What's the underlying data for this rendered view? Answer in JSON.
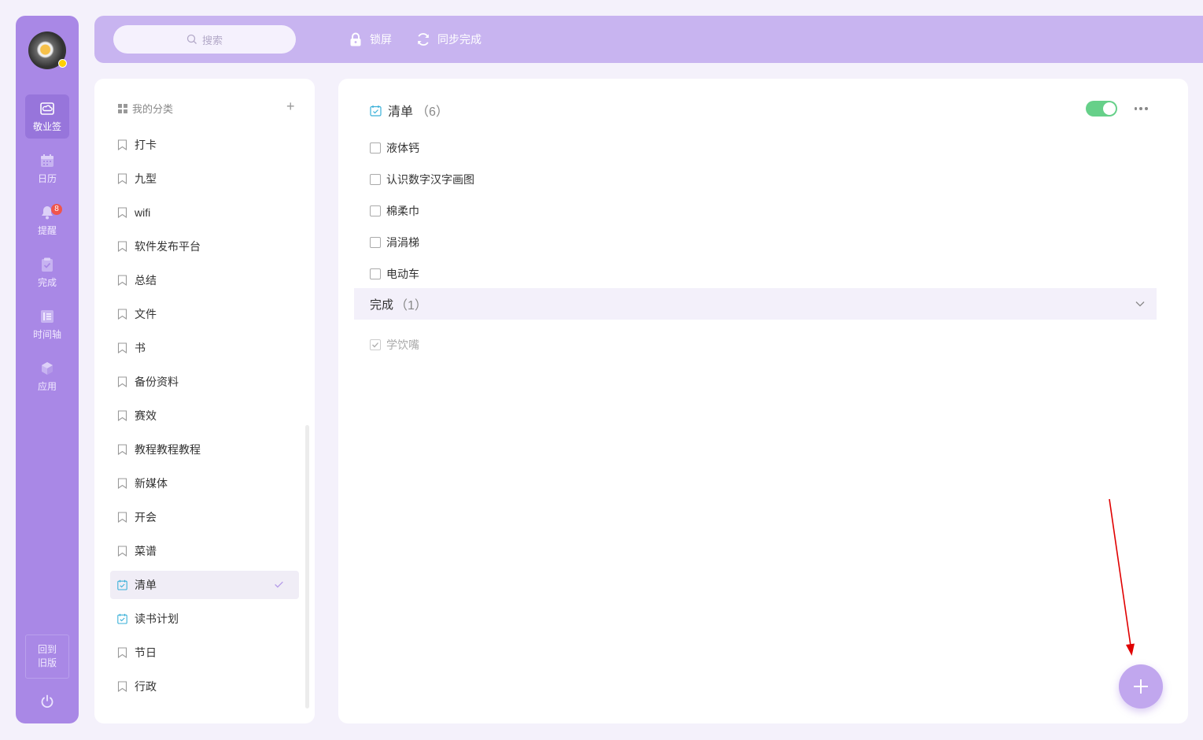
{
  "sidebar": {
    "items": [
      {
        "label": "敬业签",
        "icon": "cloud-note-icon",
        "active": true
      },
      {
        "label": "日历",
        "icon": "calendar-icon"
      },
      {
        "label": "提醒",
        "icon": "bell-icon",
        "badge": "8"
      },
      {
        "label": "完成",
        "icon": "clipboard-check-icon"
      },
      {
        "label": "时间轴",
        "icon": "timeline-icon"
      },
      {
        "label": "应用",
        "icon": "cube-icon"
      }
    ],
    "old_version_line1": "回到",
    "old_version_line2": "旧版"
  },
  "topbar": {
    "search_placeholder": "搜索",
    "lock_label": "锁屏",
    "sync_label": "同步完成"
  },
  "categories": {
    "header": "我的分类",
    "add_symbol": "+",
    "items": [
      {
        "label": "打卡",
        "icon": "bookmark-icon"
      },
      {
        "label": "九型",
        "icon": "bookmark-icon"
      },
      {
        "label": "wifi",
        "icon": "bookmark-icon"
      },
      {
        "label": "软件发布平台",
        "icon": "bookmark-icon"
      },
      {
        "label": "总结",
        "icon": "bookmark-icon"
      },
      {
        "label": "文件",
        "icon": "bookmark-icon"
      },
      {
        "label": "书",
        "icon": "bookmark-icon"
      },
      {
        "label": "备份资料",
        "icon": "bookmark-icon"
      },
      {
        "label": "赛效",
        "icon": "bookmark-icon"
      },
      {
        "label": "教程教程教程",
        "icon": "bookmark-icon"
      },
      {
        "label": "新媒体",
        "icon": "bookmark-icon"
      },
      {
        "label": "开会",
        "icon": "bookmark-icon"
      },
      {
        "label": "菜谱",
        "icon": "bookmark-icon"
      },
      {
        "label": "清单",
        "icon": "calendar-check-icon",
        "selected": true
      },
      {
        "label": "读书计划",
        "icon": "calendar-check-icon"
      },
      {
        "label": "节日",
        "icon": "bookmark-icon"
      },
      {
        "label": "行政",
        "icon": "bookmark-icon"
      }
    ]
  },
  "main": {
    "title": "清单",
    "count": "（6）",
    "toggle_on": true,
    "tasks": [
      "液体钙",
      "认识数字汉字画图",
      "棉柔巾",
      "涓涓梯",
      "电动车"
    ],
    "done_section": {
      "label": "完成",
      "count": "（1）",
      "tasks": [
        "学饮嘴"
      ]
    }
  },
  "colors": {
    "sidebar_bg": "#a988e6",
    "topbar_bg": "#c8b4f0",
    "accent": "#a988e6",
    "toggle_on": "#66d089",
    "badge": "#f0554b",
    "annotation_arrow": "#e00000"
  }
}
